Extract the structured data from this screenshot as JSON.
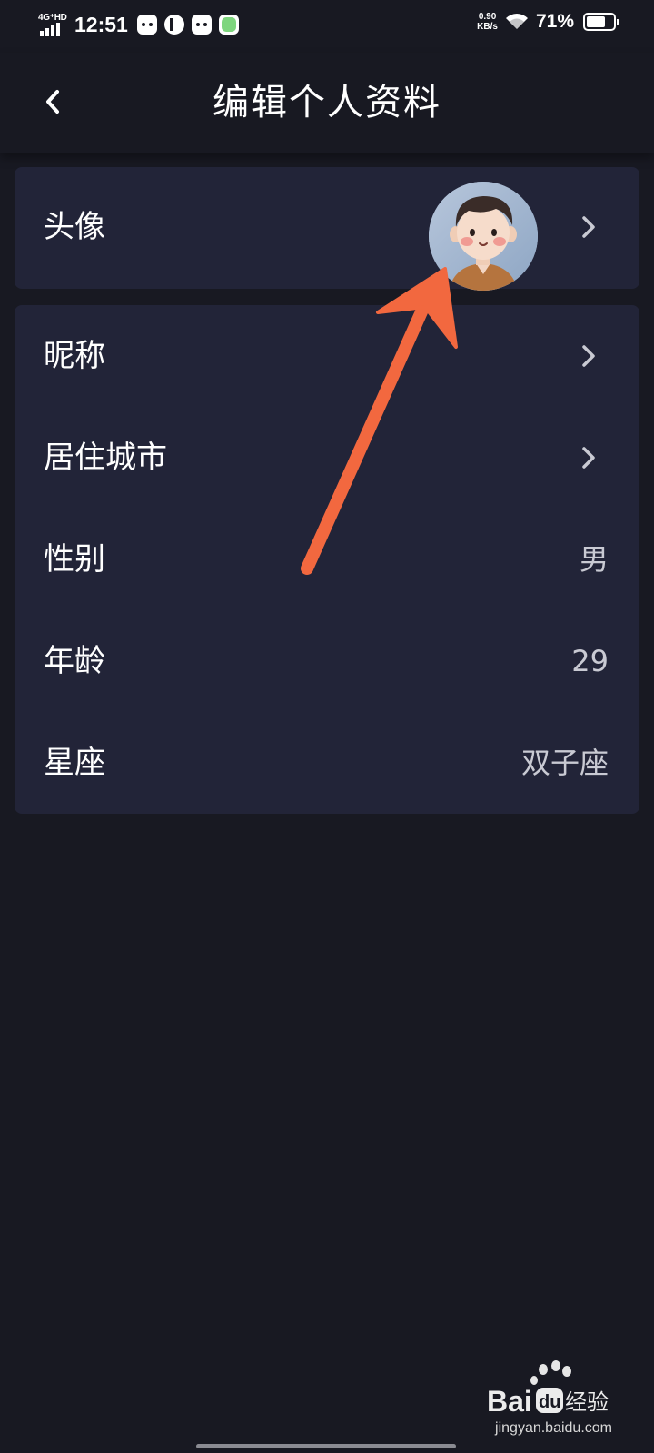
{
  "status_bar": {
    "network": "4G⁺HD",
    "time": "12:51",
    "speed_value": "0.90",
    "speed_unit": "KB/s",
    "battery_percent": "71%",
    "battery_level": 0.71,
    "icons": [
      "android-app-icon",
      "lock-app-icon",
      "android-app-icon",
      "green-app-icon"
    ]
  },
  "header": {
    "title": "编辑个人资料",
    "back_icon": "chevron-left-icon"
  },
  "avatar_card": {
    "label": "头像",
    "chevron_icon": "chevron-right-icon"
  },
  "info_card": {
    "rows": [
      {
        "label": "昵称",
        "value": "",
        "has_chevron": true
      },
      {
        "label": "居住城市",
        "value": "",
        "has_chevron": true
      },
      {
        "label": "性别",
        "value": "男",
        "has_chevron": false
      },
      {
        "label": "年龄",
        "value": "29",
        "has_chevron": false
      },
      {
        "label": "星座",
        "value": "双子座",
        "has_chevron": false
      }
    ]
  },
  "watermark": {
    "brand_text": "Bai du 经验",
    "url": "jingyan.baidu.com"
  },
  "colors": {
    "background": "#181922",
    "card": "#222438",
    "text": "#ffffff",
    "value_text": "#c9cad3",
    "annotation_arrow": "#f2683f"
  }
}
